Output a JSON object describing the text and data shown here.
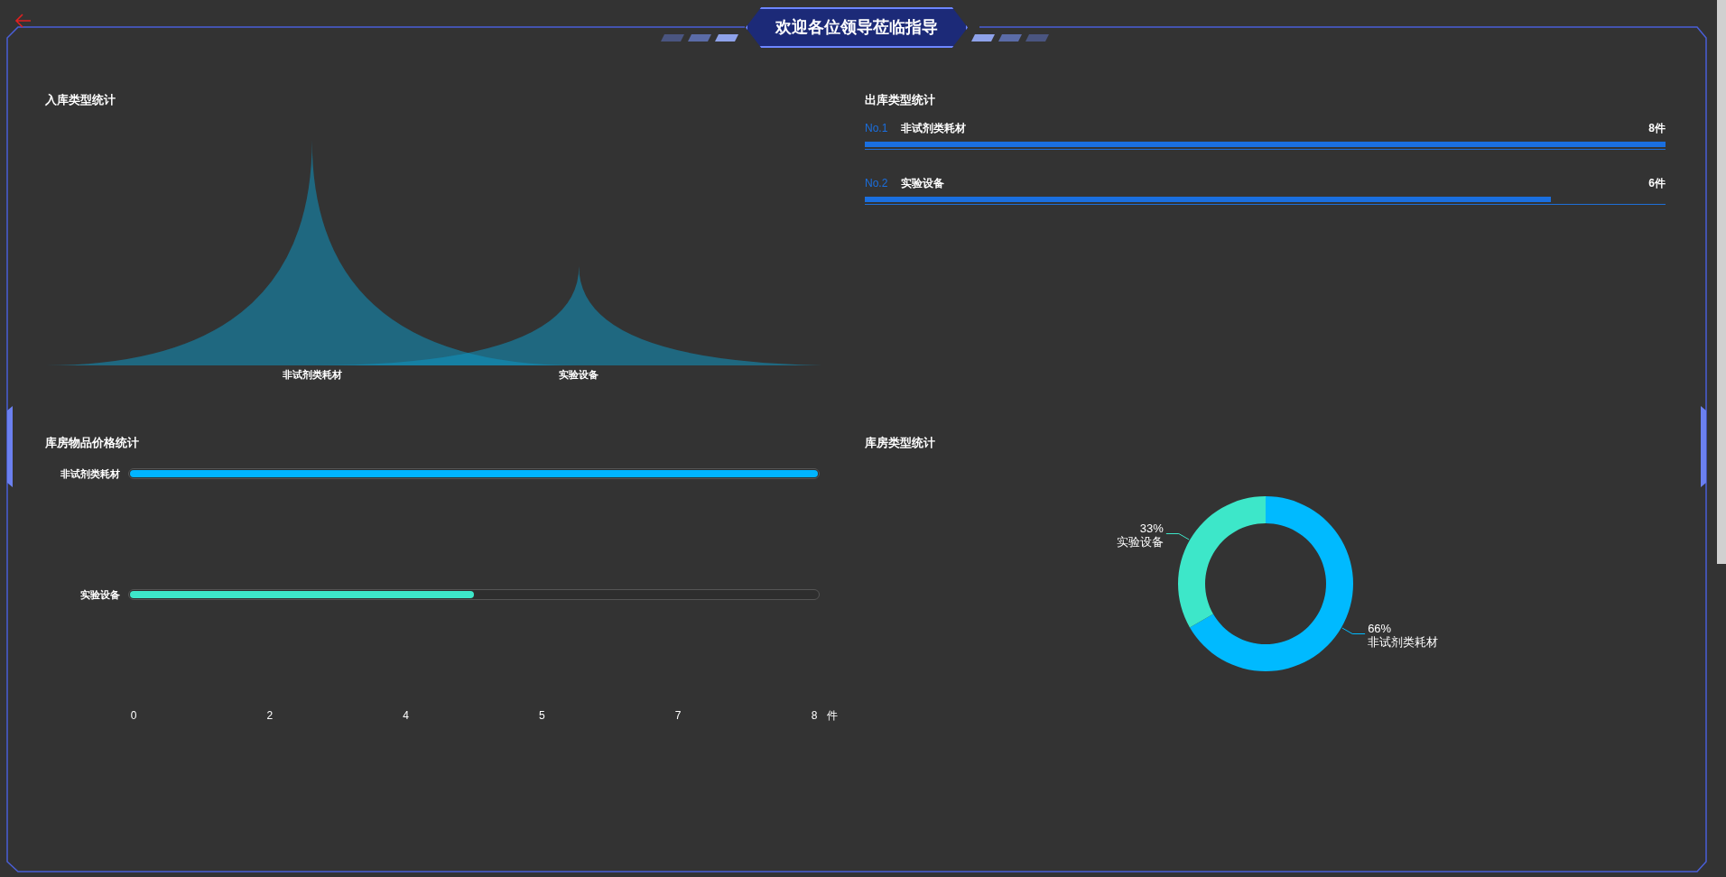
{
  "header": {
    "title": "欢迎各位领导莅临指导"
  },
  "inbound": {
    "title": "入库类型统计",
    "categories": [
      "非试剂类耗材",
      "实验设备"
    ]
  },
  "outbound": {
    "title": "出库类型统计",
    "items": [
      {
        "rank": "No.1",
        "name": "非试剂类耗材",
        "count": "8件",
        "level": 1
      },
      {
        "rank": "No.2",
        "name": "实验设备",
        "count": "6件",
        "level": 0.857
      }
    ]
  },
  "price": {
    "title": "库房物品价格统计",
    "rows": [
      {
        "label": "非试剂类耗材",
        "level": 1,
        "color": "#00b4ff"
      },
      {
        "label": "实验设备",
        "level": 0.5,
        "color": "#3de7c9"
      }
    ],
    "ticks": [
      "0",
      "2",
      "4",
      "5",
      "7",
      "8"
    ],
    "unit": "件"
  },
  "storage": {
    "title": "库房类型统计",
    "chart_data": {
      "type": "donut",
      "categories": [
        "非试剂类耗材",
        "实验设备"
      ],
      "values": [
        66,
        33
      ],
      "value_labels": [
        "66%",
        "33%"
      ]
    }
  }
}
